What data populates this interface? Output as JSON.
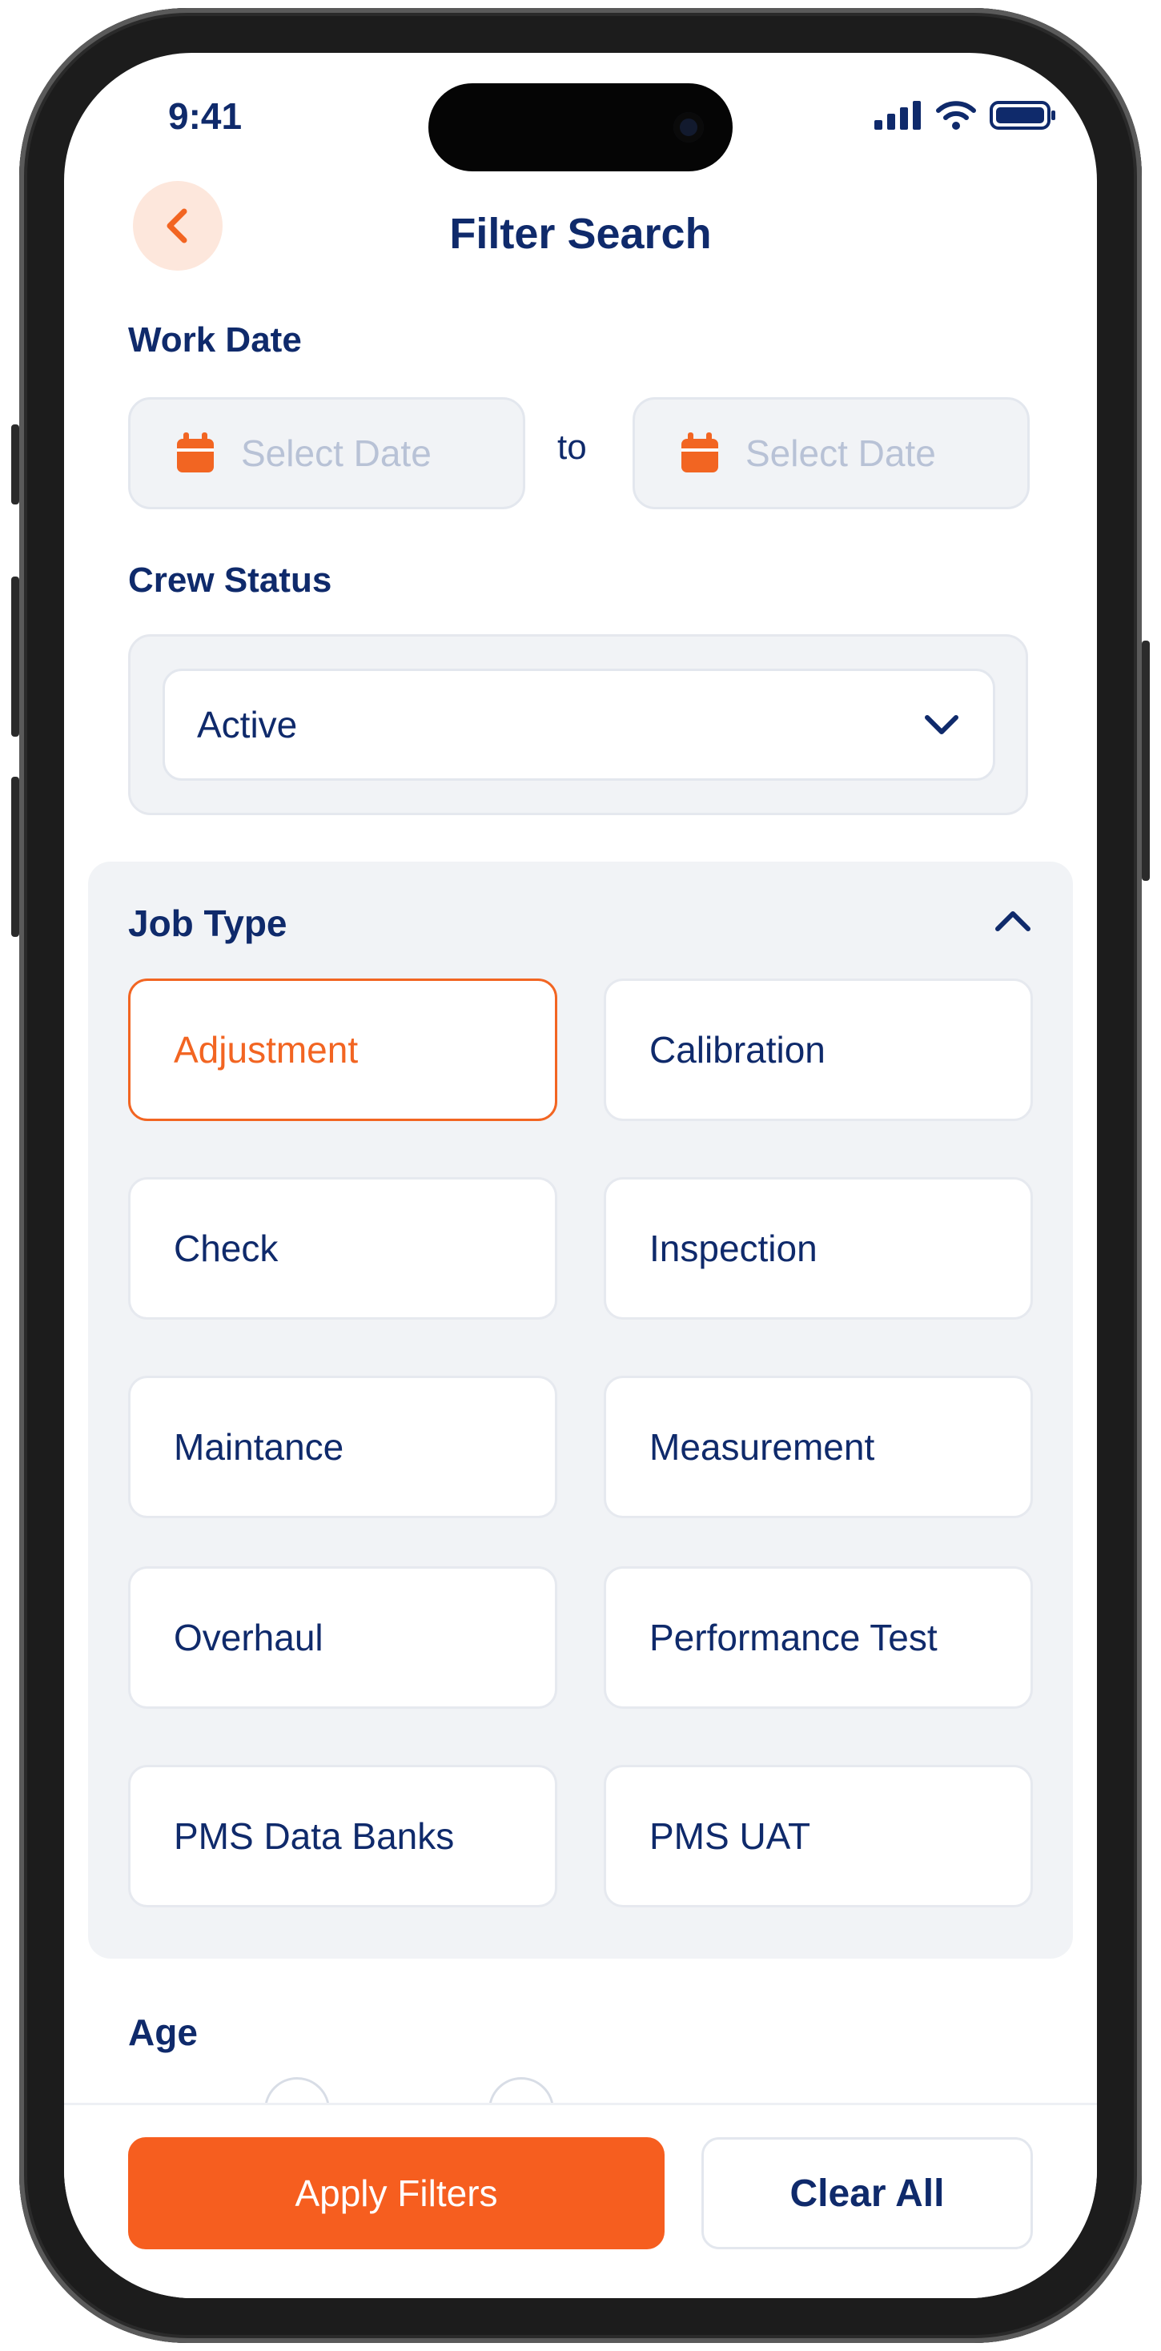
{
  "status_bar": {
    "time": "9:41"
  },
  "header": {
    "title": "Filter Search",
    "back_icon": "chevron-left-icon"
  },
  "work_date": {
    "label": "Work Date",
    "from_placeholder": "Select Date",
    "to_text": "to",
    "to_placeholder": "Select Date",
    "icon": "calendar-icon"
  },
  "crew_status": {
    "label": "Crew Status",
    "selected": "Active",
    "icon": "chevron-down-icon"
  },
  "job_type": {
    "label": "Job Type",
    "collapse_icon": "chevron-up-icon",
    "options": [
      "Adjustment",
      "Calibration",
      "Check",
      "Inspection",
      "Maintance",
      "Measurement",
      "Overhaul",
      "Performance Test",
      "PMS Data Banks",
      "PMS UAT"
    ],
    "selected": "Adjustment"
  },
  "age": {
    "label": "Age"
  },
  "footer": {
    "apply_label": "Apply Filters",
    "clear_label": "Clear All"
  },
  "colors": {
    "accent": "#f65e1f",
    "text": "#0f2a6b",
    "panel": "#f1f3f6"
  }
}
